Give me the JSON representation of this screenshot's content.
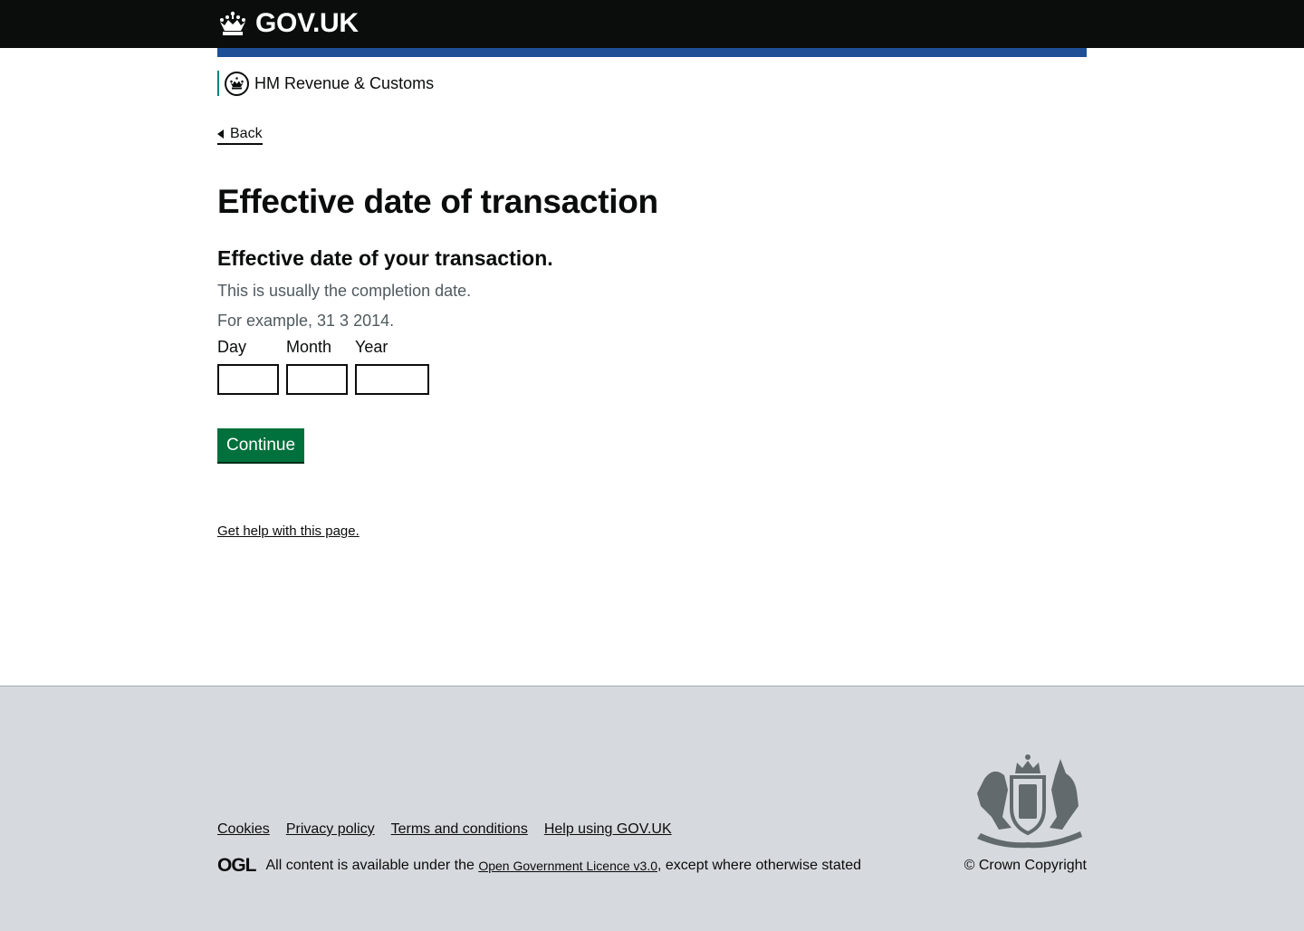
{
  "header": {
    "logo_text": "GOV.UK",
    "logo_icon": "crown-icon"
  },
  "organisation": {
    "name": "HM Revenue & Customs",
    "accent_color": "#00857d"
  },
  "nav": {
    "back_label": "Back"
  },
  "page": {
    "title": "Effective date of transaction",
    "question": "Effective date of your transaction.",
    "hint_line1": "This is usually the completion date.",
    "hint_line2": "For example, 31 3 2014.",
    "date_fields": {
      "day_label": "Day",
      "month_label": "Month",
      "year_label": "Year",
      "day_value": "",
      "month_value": "",
      "year_value": ""
    },
    "continue_label": "Continue",
    "help_link": "Get help with this page."
  },
  "footer": {
    "links": [
      "Cookies",
      "Privacy policy",
      "Terms and conditions",
      "Help using GOV.UK"
    ],
    "ogl_mark": "OGL",
    "licence_prefix": "All content is available under the",
    "licence_link": "Open Government Licence v3.0",
    "licence_suffix": ", except where otherwise stated",
    "copyright": "© Crown Copyright",
    "crest_icon": "royal-coat-of-arms-icon"
  },
  "colors": {
    "header_bg": "#0b0c0c",
    "brand_bar": "#1d4e96",
    "button_bg": "#00703c",
    "footer_bg": "#d6dade",
    "hint_text": "#505a5f"
  }
}
